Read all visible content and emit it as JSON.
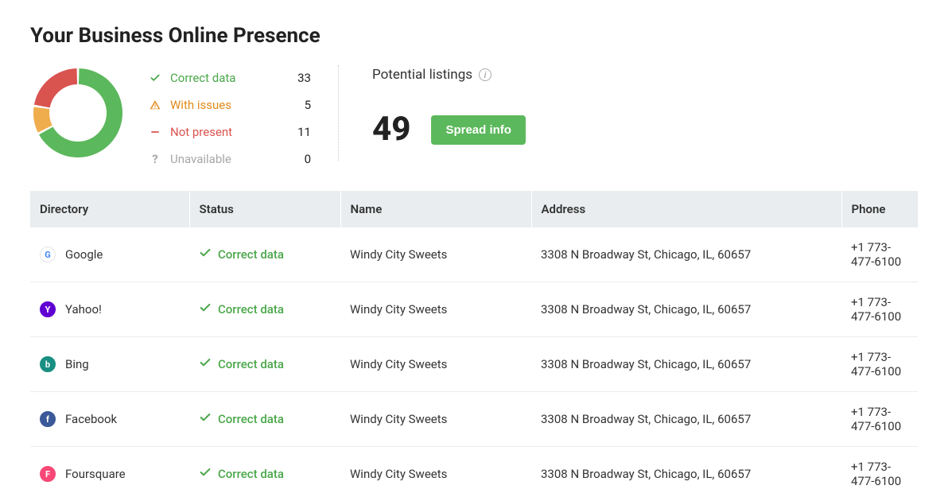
{
  "title": "Your Business Online Presence",
  "legend": {
    "correct": {
      "label": "Correct data",
      "count": 33
    },
    "issues": {
      "label": "With issues",
      "count": 5
    },
    "not_present": {
      "label": "Not present",
      "count": 11
    },
    "unavailable": {
      "label": "Unavailable",
      "count": 0
    }
  },
  "potential": {
    "label": "Potential listings",
    "value": 49,
    "button": "Spread info"
  },
  "columns": {
    "directory": "Directory",
    "status": "Status",
    "name": "Name",
    "address": "Address",
    "phone": "Phone"
  },
  "listings": [
    {
      "directory": "Google",
      "logo_bg": "#ffffff",
      "logo_text_color": "#4285F4",
      "logo_text": "G",
      "logo_border": "#e5e5e5",
      "status": "Correct data",
      "name": "Windy City Sweets",
      "address": "3308 N Broadway St, Chicago, IL, 60657",
      "phone": "+1 773-477-6100"
    },
    {
      "directory": "Yahoo!",
      "logo_bg": "#5f01d1",
      "logo_text_color": "#ffffff",
      "logo_text": "Y",
      "logo_border": "#5f01d1",
      "status": "Correct data",
      "name": "Windy City Sweets",
      "address": "3308 N Broadway St, Chicago, IL, 60657",
      "phone": "+1 773-477-6100"
    },
    {
      "directory": "Bing",
      "logo_bg": "#188f82",
      "logo_text_color": "#ffffff",
      "logo_text": "b",
      "logo_border": "#188f82",
      "status": "Correct data",
      "name": "Windy City Sweets",
      "address": "3308 N Broadway St, Chicago, IL, 60657",
      "phone": "+1 773-477-6100"
    },
    {
      "directory": "Facebook",
      "logo_bg": "#3b5998",
      "logo_text_color": "#ffffff",
      "logo_text": "f",
      "logo_border": "#3b5998",
      "status": "Correct data",
      "name": "Windy City Sweets",
      "address": "3308 N Broadway St, Chicago, IL, 60657",
      "phone": "+1 773-477-6100"
    },
    {
      "directory": "Foursquare",
      "logo_bg": "#f94877",
      "logo_text_color": "#ffffff",
      "logo_text": "F",
      "logo_border": "#f94877",
      "status": "Correct data",
      "name": "Windy City Sweets",
      "address": "3308 N Broadway St, Chicago, IL, 60657",
      "phone": "+1 773-477-6100"
    }
  ],
  "colors": {
    "correct": "#5cb85c",
    "issues": "#f0ad4e",
    "not_present": "#d9534f",
    "unavailable": "#bdbdbd"
  },
  "chart_data": {
    "type": "pie",
    "title": "Listing status breakdown",
    "categories": [
      "Correct data",
      "With issues",
      "Not present",
      "Unavailable"
    ],
    "values": [
      33,
      5,
      11,
      0
    ],
    "colors": [
      "#5cb85c",
      "#f0ad4e",
      "#d9534f",
      "#bdbdbd"
    ]
  }
}
